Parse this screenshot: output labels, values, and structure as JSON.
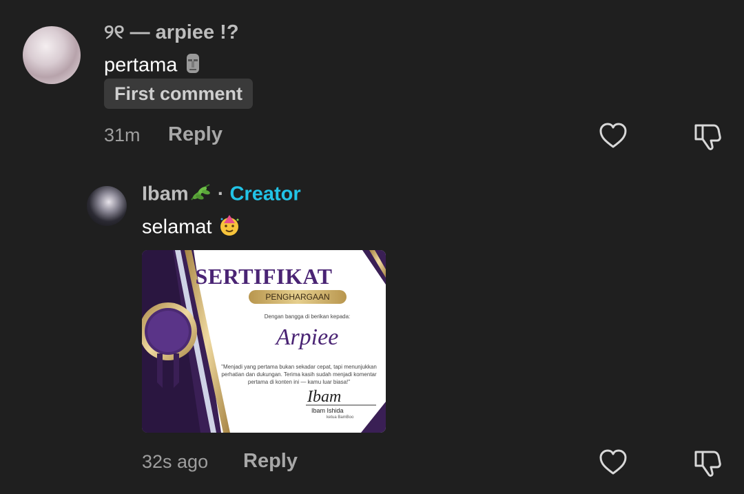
{
  "comment1": {
    "username": "୨୧ — arpiee !?",
    "text": "pertama",
    "text_emoji": "moai-emoji",
    "badge": "First comment",
    "time": "31m",
    "reply_label": "Reply"
  },
  "comment2": {
    "username": "Ibam",
    "username_emoji": "leaf-emoji",
    "separator": "·",
    "creator_label": "Creator",
    "text": "selamat",
    "text_emoji": "party-face-emoji",
    "time": "32s ago",
    "reply_label": "Reply",
    "attachment": {
      "title": "SERTIFIKAT",
      "subtitle": "PENGHARGAAN",
      "intro": "Dengan bangga di berikan kepada:",
      "recipient": "Arpiee",
      "quote": "\"Menjadi yang pertama bukan sekadar cepat, tapi menunjukkan perhatian dan dukungan. Terima kasih sudah menjadi komentar pertama di konten ini — kamu luar biasa!\"",
      "signature": "Ibam",
      "signer_name": "Ibam Ishida",
      "signer_title": "ketua BamBoo"
    }
  },
  "colors": {
    "background": "#1f1f1f",
    "creator_accent": "#22c3e6",
    "badge_bg": "#3a3a3a",
    "cert_purple": "#4a2474",
    "cert_gold": "#c9a85a"
  }
}
